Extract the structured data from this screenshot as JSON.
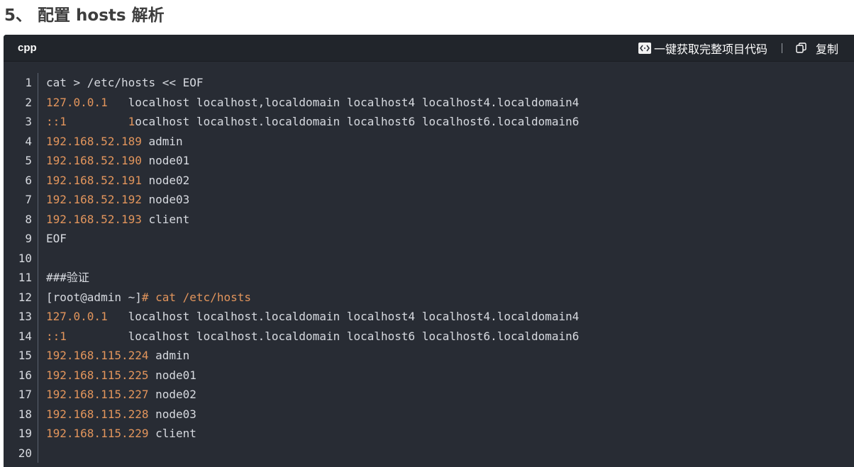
{
  "page": {
    "section_title": "5、 配置 hosts 解析"
  },
  "code_block": {
    "language": "cpp",
    "actions": {
      "get_code_label": "一键获取完整项目代码",
      "copy_label": "复制"
    },
    "lines": [
      {
        "n": "1",
        "segs": [
          {
            "t": "cat > /etc/hosts << EOF",
            "c": "plain"
          }
        ]
      },
      {
        "n": "2",
        "segs": [
          {
            "t": "127.0.0.1",
            "c": "num"
          },
          {
            "t": "   localhost localhost,localdomain localhost4 localhost4.localdomain4",
            "c": "plain"
          }
        ]
      },
      {
        "n": "3",
        "segs": [
          {
            "t": "::1",
            "c": "num"
          },
          {
            "t": "         ",
            "c": "plain"
          },
          {
            "t": "1",
            "c": "num"
          },
          {
            "t": "ocalhost localhost.localdomain localhost6 localhost6.localdomain6",
            "c": "plain"
          }
        ]
      },
      {
        "n": "4",
        "segs": [
          {
            "t": "192.168.52.189",
            "c": "num"
          },
          {
            "t": " admin",
            "c": "plain"
          }
        ]
      },
      {
        "n": "5",
        "segs": [
          {
            "t": "192.168.52.190",
            "c": "num"
          },
          {
            "t": " node01",
            "c": "plain"
          }
        ]
      },
      {
        "n": "6",
        "segs": [
          {
            "t": "192.168.52.191",
            "c": "num"
          },
          {
            "t": " node02",
            "c": "plain"
          }
        ]
      },
      {
        "n": "7",
        "segs": [
          {
            "t": "192.168.52.192",
            "c": "num"
          },
          {
            "t": " node03",
            "c": "plain"
          }
        ]
      },
      {
        "n": "8",
        "segs": [
          {
            "t": "192.168.52.193",
            "c": "num"
          },
          {
            "t": " client",
            "c": "plain"
          }
        ]
      },
      {
        "n": "9",
        "segs": [
          {
            "t": "EOF",
            "c": "plain"
          }
        ]
      },
      {
        "n": "10",
        "segs": []
      },
      {
        "n": "11",
        "segs": [
          {
            "t": "###验证",
            "c": "plain"
          }
        ]
      },
      {
        "n": "12",
        "segs": [
          {
            "t": "[root@admin ~]",
            "c": "plain"
          },
          {
            "t": "# cat /etc/hosts",
            "c": "num"
          }
        ]
      },
      {
        "n": "13",
        "segs": [
          {
            "t": "127.0.0.1",
            "c": "num"
          },
          {
            "t": "   localhost localhost.localdomain localhost4 localhost4.localdomain4",
            "c": "plain"
          }
        ]
      },
      {
        "n": "14",
        "segs": [
          {
            "t": "::1",
            "c": "num"
          },
          {
            "t": "         localhost localhost.localdomain localhost6 localhost6.localdomain6",
            "c": "plain"
          }
        ]
      },
      {
        "n": "15",
        "segs": [
          {
            "t": "192.168.115.224",
            "c": "num"
          },
          {
            "t": " admin",
            "c": "plain"
          }
        ]
      },
      {
        "n": "16",
        "segs": [
          {
            "t": "192.168.115.225",
            "c": "num"
          },
          {
            "t": " node01",
            "c": "plain"
          }
        ]
      },
      {
        "n": "17",
        "segs": [
          {
            "t": "192.168.115.227",
            "c": "num"
          },
          {
            "t": " node02",
            "c": "plain"
          }
        ]
      },
      {
        "n": "18",
        "segs": [
          {
            "t": "192.168.115.228",
            "c": "num"
          },
          {
            "t": " node03",
            "c": "plain"
          }
        ]
      },
      {
        "n": "19",
        "segs": [
          {
            "t": "192.168.115.229",
            "c": "num"
          },
          {
            "t": " client",
            "c": "plain"
          }
        ]
      },
      {
        "n": "20",
        "segs": []
      }
    ]
  },
  "icons": {
    "get_code": "code-brackets-icon",
    "copy": "copy-icon"
  },
  "colors": {
    "code_bg": "#282c34",
    "header_bg": "#21252b",
    "number_token": "#e2955c",
    "plain_text": "#d7dae0",
    "title_text": "#3d3d3d"
  }
}
